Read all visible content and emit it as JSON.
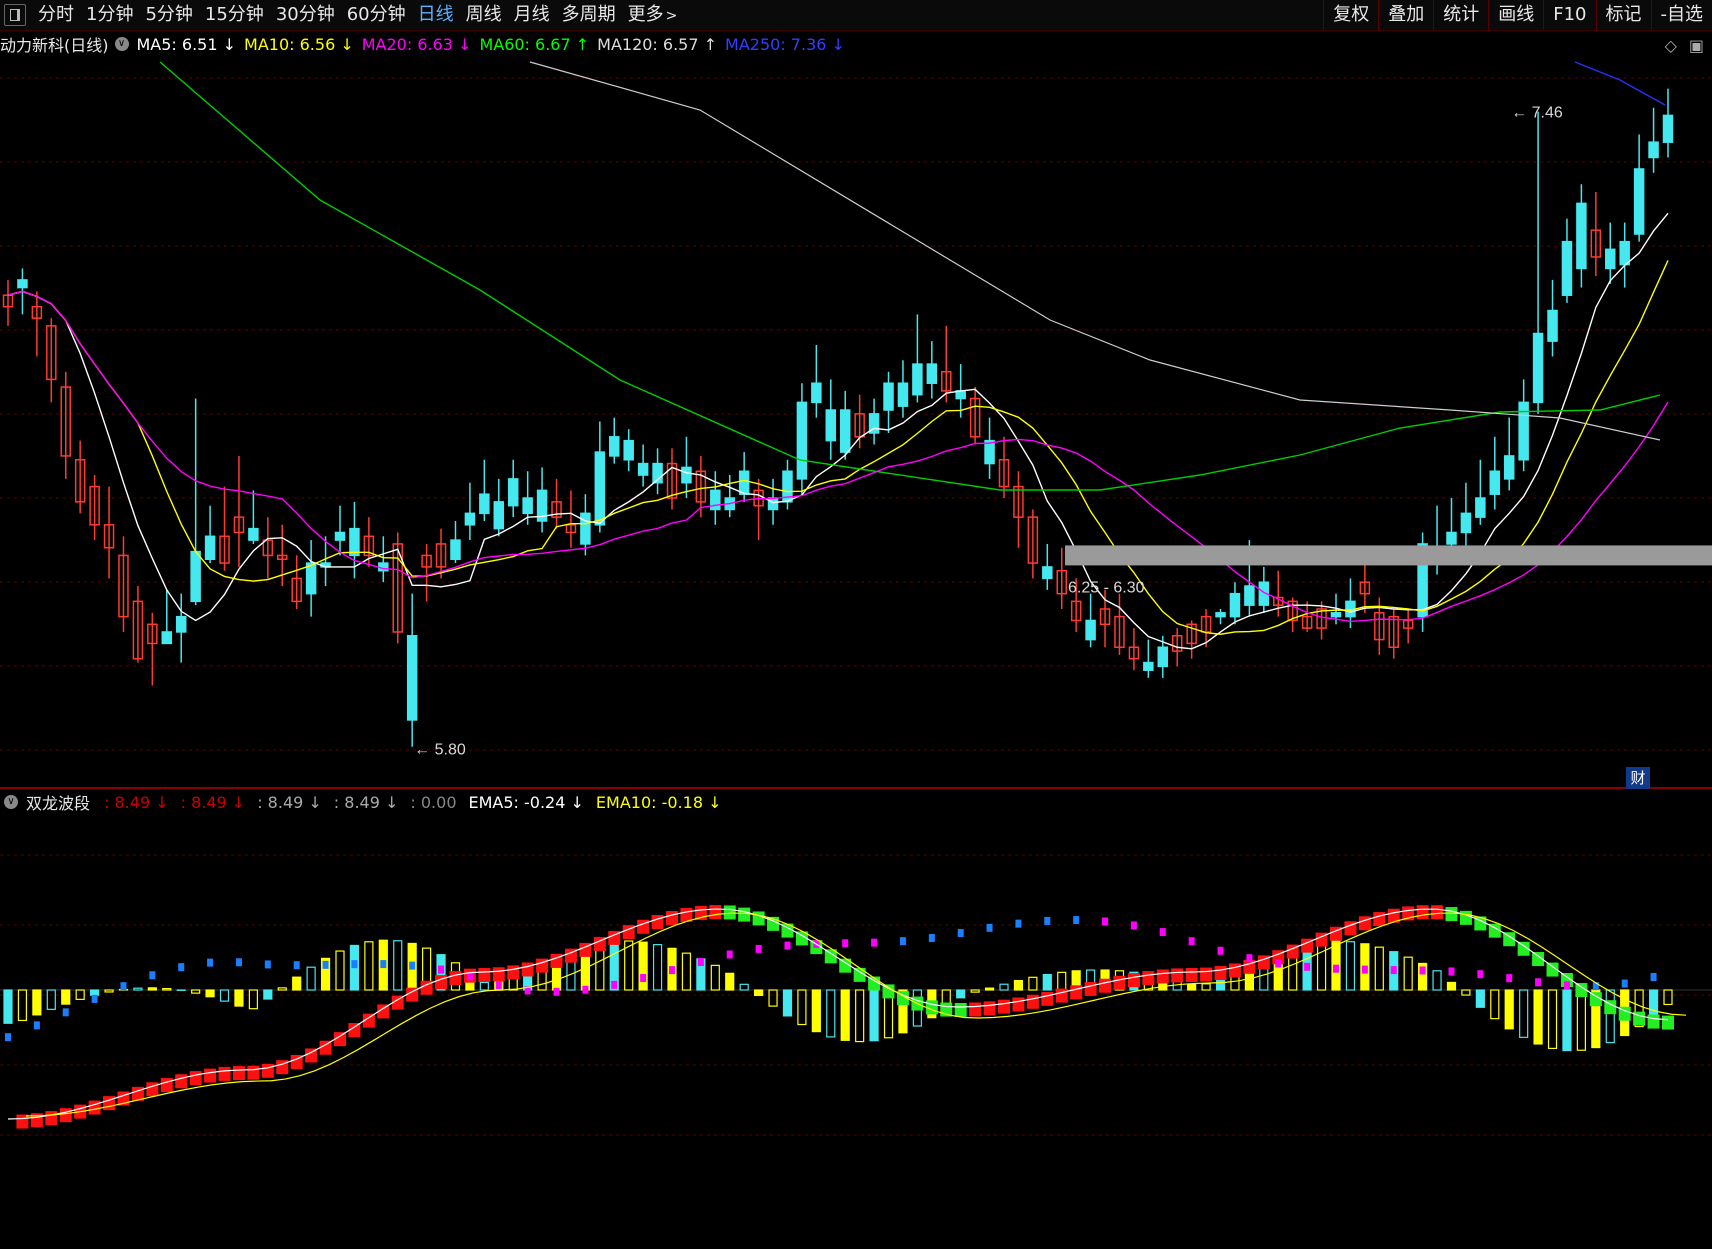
{
  "toolbar": {
    "periods": [
      {
        "label": "分时"
      },
      {
        "label": "1分钟"
      },
      {
        "label": "5分钟"
      },
      {
        "label": "15分钟"
      },
      {
        "label": "30分钟"
      },
      {
        "label": "60分钟"
      },
      {
        "label": "日线",
        "active": true
      },
      {
        "label": "周线"
      },
      {
        "label": "月线"
      },
      {
        "label": "多周期"
      },
      {
        "label": "更多"
      }
    ],
    "more_arrow": ">",
    "right_tools": [
      {
        "label": "复权"
      },
      {
        "label": "叠加"
      },
      {
        "label": "统计"
      },
      {
        "label": "画线"
      },
      {
        "label": "F10"
      },
      {
        "label": "标记"
      },
      {
        "label": "-自选"
      }
    ]
  },
  "main_info": {
    "stock_title": "动力新科(日线)",
    "ma": [
      {
        "label": "MA5: 6.51",
        "arrow": "↓",
        "color": "#ffffff"
      },
      {
        "label": "MA10: 6.56",
        "arrow": "↓",
        "color": "#ffff00"
      },
      {
        "label": "MA20: 6.63",
        "arrow": "↓",
        "color": "#ff00ff"
      },
      {
        "label": "MA60: 6.67",
        "arrow": "↑",
        "color": "#00ff00"
      },
      {
        "label": "MA120: 6.57",
        "arrow": "↑",
        "color": "#dddddd"
      },
      {
        "label": "MA250: 7.36",
        "arrow": "↓",
        "color": "#3040ff"
      }
    ]
  },
  "annotations": {
    "high_label": "7.46",
    "low_label": "5.80",
    "range_label": "6.25 - 6.30",
    "finance_badge": "财"
  },
  "indicator_info": {
    "name": "双龙波段",
    "values": [
      {
        "label": ": 8.49",
        "arrow": "↓",
        "color": "#cc0000"
      },
      {
        "label": ": 8.49",
        "arrow": "↓",
        "color": "#cc0000"
      },
      {
        "label": ": 8.49",
        "arrow": "↓",
        "color": "#aaaaaa"
      },
      {
        "label": ": 8.49",
        "arrow": "↓",
        "color": "#aaaaaa"
      },
      {
        "label": ": 0.00",
        "arrow": "",
        "color": "#888888"
      },
      {
        "label": "EMA5: -0.24",
        "arrow": "↓",
        "color": "#ffffff"
      },
      {
        "label": "EMA10: -0.18",
        "arrow": "↓",
        "color": "#ffff00"
      }
    ]
  },
  "colors": {
    "up": "#ff3b30",
    "down": "#44e8ee",
    "ma5": "#ffffff",
    "ma10": "#ffff00",
    "ma20": "#ff00ff",
    "ma60": "#00cc00",
    "ma120": "#cccccc",
    "ma250": "#2233ff",
    "grid": "#5a0000"
  },
  "chart_data": {
    "type": "candlestick",
    "ylim": [
      5.7,
      7.6
    ],
    "y_high": 7.46,
    "y_low": 5.8,
    "support_band": [
      6.25,
      6.3
    ],
    "bars": 127,
    "candles": [
      [
        6.95,
        7.02,
        6.98,
        6.9
      ],
      [
        7.02,
        7.05,
        7.0,
        6.93
      ],
      [
        6.92,
        6.99,
        6.95,
        6.82
      ],
      [
        6.76,
        6.92,
        6.9,
        6.7
      ],
      [
        6.56,
        6.78,
        6.74,
        6.5
      ],
      [
        6.44,
        6.6,
        6.55,
        6.41
      ],
      [
        6.38,
        6.51,
        6.48,
        6.34
      ],
      [
        6.32,
        6.48,
        6.38,
        6.24
      ],
      [
        6.14,
        6.35,
        6.3,
        6.1
      ],
      [
        6.03,
        6.22,
        6.18,
        6.02
      ],
      [
        6.07,
        6.15,
        6.12,
        5.96
      ],
      [
        6.1,
        6.21,
        6.07,
        6.07
      ],
      [
        6.14,
        6.2,
        6.1,
        6.02
      ],
      [
        6.31,
        6.71,
        6.18,
        6.17
      ],
      [
        6.35,
        6.43,
        6.29,
        6.28
      ],
      [
        6.28,
        6.48,
        6.35,
        6.26
      ],
      [
        6.36,
        6.56,
        6.4,
        6.27
      ],
      [
        6.37,
        6.47,
        6.34,
        6.33
      ],
      [
        6.3,
        6.4,
        6.34,
        6.24
      ],
      [
        6.29,
        6.38,
        6.3,
        6.22
      ],
      [
        6.18,
        6.3,
        6.24,
        6.16
      ],
      [
        6.28,
        6.34,
        6.2,
        6.14
      ],
      [
        6.28,
        6.35,
        6.27,
        6.22
      ],
      [
        6.36,
        6.43,
        6.34,
        6.3
      ],
      [
        6.37,
        6.44,
        6.3,
        6.24
      ],
      [
        6.3,
        6.4,
        6.35,
        6.27
      ],
      [
        6.28,
        6.35,
        6.26,
        6.23
      ],
      [
        6.1,
        6.36,
        6.33,
        6.07
      ],
      [
        6.09,
        6.2,
        5.87,
        5.8
      ],
      [
        6.27,
        6.33,
        6.3,
        6.18
      ],
      [
        6.27,
        6.37,
        6.33,
        6.24
      ],
      [
        6.34,
        6.39,
        6.29,
        6.28
      ],
      [
        6.41,
        6.49,
        6.38,
        6.34
      ],
      [
        6.46,
        6.55,
        6.41,
        6.39
      ],
      [
        6.44,
        6.5,
        6.37,
        6.35
      ],
      [
        6.5,
        6.55,
        6.43,
        6.4
      ],
      [
        6.45,
        6.52,
        6.41,
        6.38
      ],
      [
        6.47,
        6.53,
        6.39,
        6.36
      ],
      [
        6.4,
        6.5,
        6.44,
        6.37
      ],
      [
        6.36,
        6.47,
        6.38,
        6.32
      ],
      [
        6.41,
        6.46,
        6.33,
        6.3
      ],
      [
        6.57,
        6.65,
        6.38,
        6.36
      ],
      [
        6.61,
        6.66,
        6.56,
        6.54
      ],
      [
        6.6,
        6.63,
        6.55,
        6.52
      ],
      [
        6.54,
        6.59,
        6.51,
        6.48
      ],
      [
        6.54,
        6.58,
        6.49,
        6.46
      ],
      [
        6.45,
        6.58,
        6.54,
        6.42
      ],
      [
        6.53,
        6.61,
        6.49,
        6.45
      ],
      [
        6.44,
        6.56,
        6.52,
        6.4
      ],
      [
        6.47,
        6.52,
        6.42,
        6.38
      ],
      [
        6.45,
        6.51,
        6.42,
        6.4
      ],
      [
        6.52,
        6.57,
        6.46,
        6.44
      ],
      [
        6.43,
        6.5,
        6.47,
        6.34
      ],
      [
        6.45,
        6.5,
        6.42,
        6.38
      ],
      [
        6.52,
        6.55,
        6.44,
        6.42
      ],
      [
        6.7,
        6.75,
        6.5,
        6.46
      ],
      [
        6.75,
        6.85,
        6.7,
        6.66
      ],
      [
        6.68,
        6.76,
        6.6,
        6.55
      ],
      [
        6.68,
        6.73,
        6.57,
        6.55
      ],
      [
        6.61,
        6.72,
        6.67,
        6.58
      ],
      [
        6.67,
        6.71,
        6.62,
        6.59
      ],
      [
        6.75,
        6.78,
        6.68,
        6.62
      ],
      [
        6.75,
        6.81,
        6.69,
        6.66
      ],
      [
        6.8,
        6.93,
        6.72,
        6.7
      ],
      [
        6.8,
        6.86,
        6.75,
        6.71
      ],
      [
        6.73,
        6.9,
        6.78,
        6.7
      ],
      [
        6.73,
        6.8,
        6.71,
        6.66
      ],
      [
        6.61,
        6.74,
        6.71,
        6.59
      ],
      [
        6.6,
        6.66,
        6.54,
        6.5
      ],
      [
        6.48,
        6.61,
        6.55,
        6.45
      ],
      [
        6.4,
        6.52,
        6.48,
        6.32
      ],
      [
        6.28,
        6.42,
        6.4,
        6.24
      ],
      [
        6.27,
        6.33,
        6.24,
        6.21
      ],
      [
        6.2,
        6.32,
        6.26,
        6.16
      ],
      [
        6.13,
        6.24,
        6.18,
        6.1
      ],
      [
        6.13,
        6.2,
        6.08,
        6.06
      ],
      [
        6.12,
        6.21,
        6.16,
        6.06
      ],
      [
        6.06,
        6.2,
        6.14,
        6.04
      ],
      [
        6.03,
        6.11,
        6.06,
        6.0
      ],
      [
        6.02,
        6.08,
        6.0,
        5.98
      ],
      [
        6.06,
        6.09,
        6.01,
        5.98
      ],
      [
        6.05,
        6.11,
        6.09,
        6.01
      ],
      [
        6.07,
        6.13,
        6.12,
        6.03
      ],
      [
        6.1,
        6.16,
        6.14,
        6.06
      ],
      [
        6.15,
        6.16,
        6.14,
        6.12
      ],
      [
        6.2,
        6.23,
        6.14,
        6.12
      ],
      [
        6.22,
        6.34,
        6.17,
        6.14
      ],
      [
        6.23,
        6.27,
        6.17,
        6.15
      ],
      [
        6.17,
        6.26,
        6.19,
        6.14
      ],
      [
        6.13,
        6.19,
        6.18,
        6.1
      ],
      [
        6.11,
        6.18,
        6.14,
        6.1
      ],
      [
        6.11,
        6.18,
        6.16,
        6.08
      ],
      [
        6.15,
        6.2,
        6.14,
        6.12
      ],
      [
        6.18,
        6.24,
        6.14,
        6.11
      ],
      [
        6.2,
        6.3,
        6.23,
        6.15
      ],
      [
        6.08,
        6.19,
        6.15,
        6.04
      ],
      [
        6.06,
        6.16,
        6.14,
        6.03
      ],
      [
        6.11,
        6.16,
        6.13,
        6.07
      ],
      [
        6.33,
        6.36,
        6.14,
        6.1
      ],
      [
        6.32,
        6.43,
        6.3,
        6.25
      ],
      [
        6.36,
        6.45,
        6.33,
        6.28
      ],
      [
        6.41,
        6.49,
        6.36,
        6.32
      ],
      [
        6.45,
        6.55,
        6.4,
        6.38
      ],
      [
        6.52,
        6.61,
        6.46,
        6.42
      ],
      [
        6.56,
        6.66,
        6.5,
        6.47
      ],
      [
        6.7,
        6.76,
        6.55,
        6.52
      ],
      [
        6.88,
        7.46,
        6.7,
        6.67
      ],
      [
        6.94,
        7.02,
        6.86,
        6.82
      ],
      [
        7.12,
        7.18,
        6.98,
        6.96
      ],
      [
        7.22,
        7.27,
        7.05,
        7.0
      ],
      [
        7.08,
        7.25,
        7.15,
        7.03
      ],
      [
        7.1,
        7.17,
        7.05,
        7.01
      ],
      [
        7.12,
        7.17,
        7.06,
        7.0
      ],
      [
        7.31,
        7.4,
        7.14,
        7.12
      ],
      [
        7.38,
        7.47,
        7.34,
        7.3
      ],
      [
        7.45,
        7.52,
        7.38,
        7.34
      ]
    ],
    "indicator": {
      "ema5": [
        -0.95,
        -0.6,
        0.1,
        0.55,
        -0.15,
        0.1,
        0.55,
        -0.24
      ],
      "ema10": [
        -0.9,
        -0.65,
        0.0,
        0.55,
        -0.2,
        0.05,
        0.55,
        -0.18
      ]
    }
  }
}
